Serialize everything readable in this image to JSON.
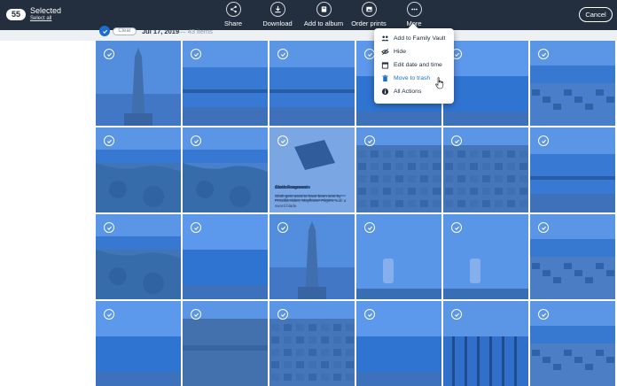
{
  "topbar": {
    "selected_count": "55",
    "selected_label": "Selected",
    "select_all_label": "Select all",
    "actions": [
      {
        "label": "Share",
        "icon": "share-icon"
      },
      {
        "label": "Download",
        "icon": "download-icon"
      },
      {
        "label": "Add to album",
        "icon": "album-icon"
      },
      {
        "label": "Order prints",
        "icon": "prints-icon"
      },
      {
        "label": "More",
        "icon": "more-icon"
      }
    ],
    "cancel_label": "Cancel"
  },
  "group_header": {
    "pill_label": "Clear",
    "date": "Jul 17, 2019",
    "count": "— 43 items"
  },
  "menu": {
    "items": [
      {
        "label": "Add to Family Vault",
        "icon": "family-vault-icon",
        "active": false
      },
      {
        "label": "Hide",
        "icon": "hide-eye-icon",
        "active": false
      },
      {
        "label": "Edit date and time",
        "icon": "calendar-icon",
        "active": false
      },
      {
        "label": "Move to trash",
        "icon": "trash-icon",
        "active": true
      },
      {
        "label": "All Actions",
        "icon": "info-icon",
        "active": false
      }
    ]
  },
  "photo_tile": {
    "caption_title": "Cloth Fragment",
    "caption_text": "Cloth gem used to have been sent by Priscilla Alden, Mayflower Pilgrim, with a sword blade."
  },
  "colors": {
    "topbar": "#232f3e",
    "accent": "#1a6fcf",
    "selection_overlay": "rgba(30,110,230,0.45)"
  }
}
